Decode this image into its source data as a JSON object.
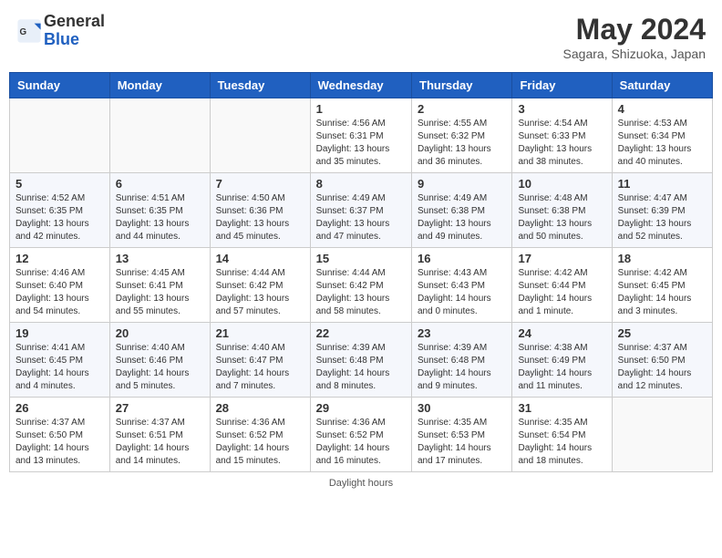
{
  "header": {
    "logo_line1": "General",
    "logo_line2": "Blue",
    "main_title": "May 2024",
    "subtitle": "Sagara, Shizuoka, Japan"
  },
  "days_of_week": [
    "Sunday",
    "Monday",
    "Tuesday",
    "Wednesday",
    "Thursday",
    "Friday",
    "Saturday"
  ],
  "weeks": [
    [
      {
        "day": "",
        "info": ""
      },
      {
        "day": "",
        "info": ""
      },
      {
        "day": "",
        "info": ""
      },
      {
        "day": "1",
        "info": "Sunrise: 4:56 AM\nSunset: 6:31 PM\nDaylight: 13 hours\nand 35 minutes."
      },
      {
        "day": "2",
        "info": "Sunrise: 4:55 AM\nSunset: 6:32 PM\nDaylight: 13 hours\nand 36 minutes."
      },
      {
        "day": "3",
        "info": "Sunrise: 4:54 AM\nSunset: 6:33 PM\nDaylight: 13 hours\nand 38 minutes."
      },
      {
        "day": "4",
        "info": "Sunrise: 4:53 AM\nSunset: 6:34 PM\nDaylight: 13 hours\nand 40 minutes."
      }
    ],
    [
      {
        "day": "5",
        "info": "Sunrise: 4:52 AM\nSunset: 6:35 PM\nDaylight: 13 hours\nand 42 minutes."
      },
      {
        "day": "6",
        "info": "Sunrise: 4:51 AM\nSunset: 6:35 PM\nDaylight: 13 hours\nand 44 minutes."
      },
      {
        "day": "7",
        "info": "Sunrise: 4:50 AM\nSunset: 6:36 PM\nDaylight: 13 hours\nand 45 minutes."
      },
      {
        "day": "8",
        "info": "Sunrise: 4:49 AM\nSunset: 6:37 PM\nDaylight: 13 hours\nand 47 minutes."
      },
      {
        "day": "9",
        "info": "Sunrise: 4:49 AM\nSunset: 6:38 PM\nDaylight: 13 hours\nand 49 minutes."
      },
      {
        "day": "10",
        "info": "Sunrise: 4:48 AM\nSunset: 6:38 PM\nDaylight: 13 hours\nand 50 minutes."
      },
      {
        "day": "11",
        "info": "Sunrise: 4:47 AM\nSunset: 6:39 PM\nDaylight: 13 hours\nand 52 minutes."
      }
    ],
    [
      {
        "day": "12",
        "info": "Sunrise: 4:46 AM\nSunset: 6:40 PM\nDaylight: 13 hours\nand 54 minutes."
      },
      {
        "day": "13",
        "info": "Sunrise: 4:45 AM\nSunset: 6:41 PM\nDaylight: 13 hours\nand 55 minutes."
      },
      {
        "day": "14",
        "info": "Sunrise: 4:44 AM\nSunset: 6:42 PM\nDaylight: 13 hours\nand 57 minutes."
      },
      {
        "day": "15",
        "info": "Sunrise: 4:44 AM\nSunset: 6:42 PM\nDaylight: 13 hours\nand 58 minutes."
      },
      {
        "day": "16",
        "info": "Sunrise: 4:43 AM\nSunset: 6:43 PM\nDaylight: 14 hours\nand 0 minutes."
      },
      {
        "day": "17",
        "info": "Sunrise: 4:42 AM\nSunset: 6:44 PM\nDaylight: 14 hours\nand 1 minute."
      },
      {
        "day": "18",
        "info": "Sunrise: 4:42 AM\nSunset: 6:45 PM\nDaylight: 14 hours\nand 3 minutes."
      }
    ],
    [
      {
        "day": "19",
        "info": "Sunrise: 4:41 AM\nSunset: 6:45 PM\nDaylight: 14 hours\nand 4 minutes."
      },
      {
        "day": "20",
        "info": "Sunrise: 4:40 AM\nSunset: 6:46 PM\nDaylight: 14 hours\nand 5 minutes."
      },
      {
        "day": "21",
        "info": "Sunrise: 4:40 AM\nSunset: 6:47 PM\nDaylight: 14 hours\nand 7 minutes."
      },
      {
        "day": "22",
        "info": "Sunrise: 4:39 AM\nSunset: 6:48 PM\nDaylight: 14 hours\nand 8 minutes."
      },
      {
        "day": "23",
        "info": "Sunrise: 4:39 AM\nSunset: 6:48 PM\nDaylight: 14 hours\nand 9 minutes."
      },
      {
        "day": "24",
        "info": "Sunrise: 4:38 AM\nSunset: 6:49 PM\nDaylight: 14 hours\nand 11 minutes."
      },
      {
        "day": "25",
        "info": "Sunrise: 4:37 AM\nSunset: 6:50 PM\nDaylight: 14 hours\nand 12 minutes."
      }
    ],
    [
      {
        "day": "26",
        "info": "Sunrise: 4:37 AM\nSunset: 6:50 PM\nDaylight: 14 hours\nand 13 minutes."
      },
      {
        "day": "27",
        "info": "Sunrise: 4:37 AM\nSunset: 6:51 PM\nDaylight: 14 hours\nand 14 minutes."
      },
      {
        "day": "28",
        "info": "Sunrise: 4:36 AM\nSunset: 6:52 PM\nDaylight: 14 hours\nand 15 minutes."
      },
      {
        "day": "29",
        "info": "Sunrise: 4:36 AM\nSunset: 6:52 PM\nDaylight: 14 hours\nand 16 minutes."
      },
      {
        "day": "30",
        "info": "Sunrise: 4:35 AM\nSunset: 6:53 PM\nDaylight: 14 hours\nand 17 minutes."
      },
      {
        "day": "31",
        "info": "Sunrise: 4:35 AM\nSunset: 6:54 PM\nDaylight: 14 hours\nand 18 minutes."
      },
      {
        "day": "",
        "info": ""
      }
    ]
  ],
  "footer": {
    "daylight_label": "Daylight hours"
  }
}
